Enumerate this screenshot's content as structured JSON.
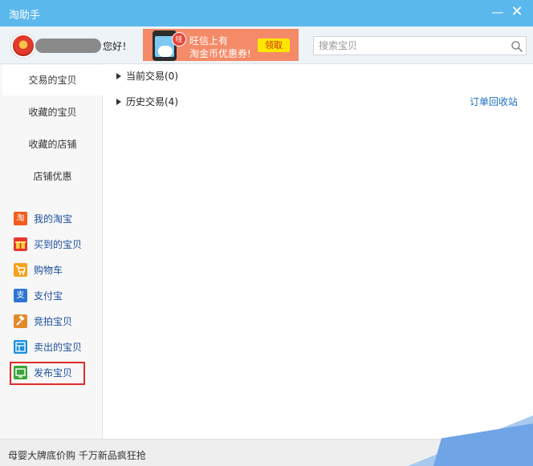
{
  "window": {
    "title": "淘助手",
    "minimize_glyph": "—",
    "close_glyph": "✕"
  },
  "header": {
    "greeting": "您好！"
  },
  "ad": {
    "badge": "哇",
    "line1": "旺信上有",
    "line2": "淘金币优惠券!",
    "claim_label": "领取"
  },
  "search": {
    "placeholder": "搜索宝贝",
    "value": ""
  },
  "sidebar": {
    "tabs": [
      {
        "label": "交易的宝贝",
        "active": true
      },
      {
        "label": "收藏的宝贝",
        "active": false
      },
      {
        "label": "收藏的店铺",
        "active": false
      },
      {
        "label": "店铺优惠",
        "active": false
      }
    ],
    "links": [
      {
        "label": "我的淘宝",
        "icon": "taobao-icon",
        "glyph": "淘",
        "color": "#f25c1e"
      },
      {
        "label": "买到的宝贝",
        "icon": "gift-icon",
        "glyph": "",
        "color": "#e8372c"
      },
      {
        "label": "购物车",
        "icon": "cart-icon",
        "glyph": "",
        "color": "#f5a11b"
      },
      {
        "label": "支付宝",
        "icon": "alipay-icon",
        "glyph": "支",
        "color": "#2b76d2"
      },
      {
        "label": "竞拍宝贝",
        "icon": "auction-hammer-icon",
        "glyph": "",
        "color": "#e3892a"
      },
      {
        "label": "卖出的宝贝",
        "icon": "sold-icon",
        "glyph": "",
        "color": "#1c8fe0"
      },
      {
        "label": "发布宝贝",
        "icon": "publish-icon",
        "glyph": "",
        "color": "#3aa539"
      }
    ]
  },
  "main": {
    "nodes": [
      {
        "label": "当前交易(0)"
      },
      {
        "label": "历史交易(4)"
      }
    ],
    "recycle_link": "订单回收站"
  },
  "footer": {
    "text": "母婴大牌底价购 千万新品疯狂抢"
  }
}
